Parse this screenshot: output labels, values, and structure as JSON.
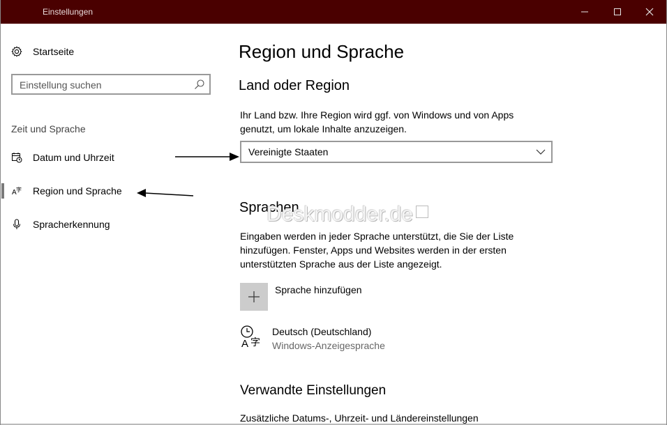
{
  "window": {
    "title": "Einstellungen",
    "titlebar_color": "#4a0000",
    "controls": {
      "minimize": "—",
      "maximize": "☐",
      "close": "✕"
    }
  },
  "sidebar": {
    "home": {
      "label": "Startseite",
      "icon": "gear-icon"
    },
    "search": {
      "placeholder": "Einstellung suchen",
      "icon": "search-icon"
    },
    "group_label": "Zeit und Sprache",
    "items": [
      {
        "label": "Datum und Uhrzeit",
        "icon": "calendar-clock-icon",
        "selected": false
      },
      {
        "label": "Region und Sprache",
        "icon": "region-language-icon",
        "selected": true
      },
      {
        "label": "Spracherkennung",
        "icon": "microphone-icon",
        "selected": false
      }
    ]
  },
  "main": {
    "title": "Region und Sprache",
    "region": {
      "heading": "Land oder Region",
      "description_line1": "Ihr Land bzw. Ihre Region wird ggf. von Windows und von Apps",
      "description_line2": "genutzt, um lokale Inhalte anzuzeigen.",
      "selected_value": "Vereinigte Staaten"
    },
    "languages": {
      "heading": "Sprachen",
      "description_line1": "Eingaben werden in jeder Sprache unterstützt, die Sie der Liste",
      "description_line2": "hinzufügen. Fenster, Apps und Websites werden in der ersten",
      "description_line3": "unterstützten Sprache aus der Liste angezeigt.",
      "add_label": "Sprache hinzufügen",
      "items": [
        {
          "name": "Deutsch (Deutschland)",
          "subtitle": "Windows-Anzeigesprache"
        }
      ]
    },
    "related": {
      "heading": "Verwandte Einstellungen",
      "link": "Zusätzliche Datums-, Uhrzeit- und Ländereinstellungen"
    }
  },
  "watermark": "Deskmodder.de"
}
